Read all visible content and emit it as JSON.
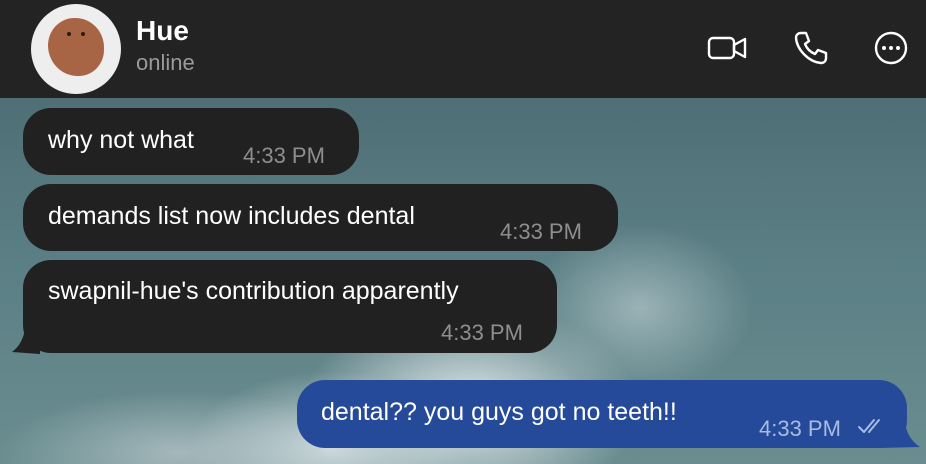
{
  "header": {
    "contact_name": "Hue",
    "status": "online",
    "icons": [
      "video-call-icon",
      "phone-icon",
      "more-options-icon"
    ]
  },
  "messages": [
    {
      "direction": "incoming",
      "text": "why not what",
      "time": "4:33 PM"
    },
    {
      "direction": "incoming",
      "text": "demands list now includes dental",
      "time": "4:33 PM"
    },
    {
      "direction": "incoming",
      "text": "swapnil-hue's contribution apparently",
      "time": "4:33 PM"
    },
    {
      "direction": "outgoing",
      "text": "dental?? you guys got no teeth!!",
      "time": "4:33 PM",
      "read": true
    }
  ],
  "colors": {
    "header_bg": "#232323",
    "incoming_bubble": "#212121",
    "outgoing_bubble": "#254a9a",
    "timestamp": "#8e8e8e"
  }
}
